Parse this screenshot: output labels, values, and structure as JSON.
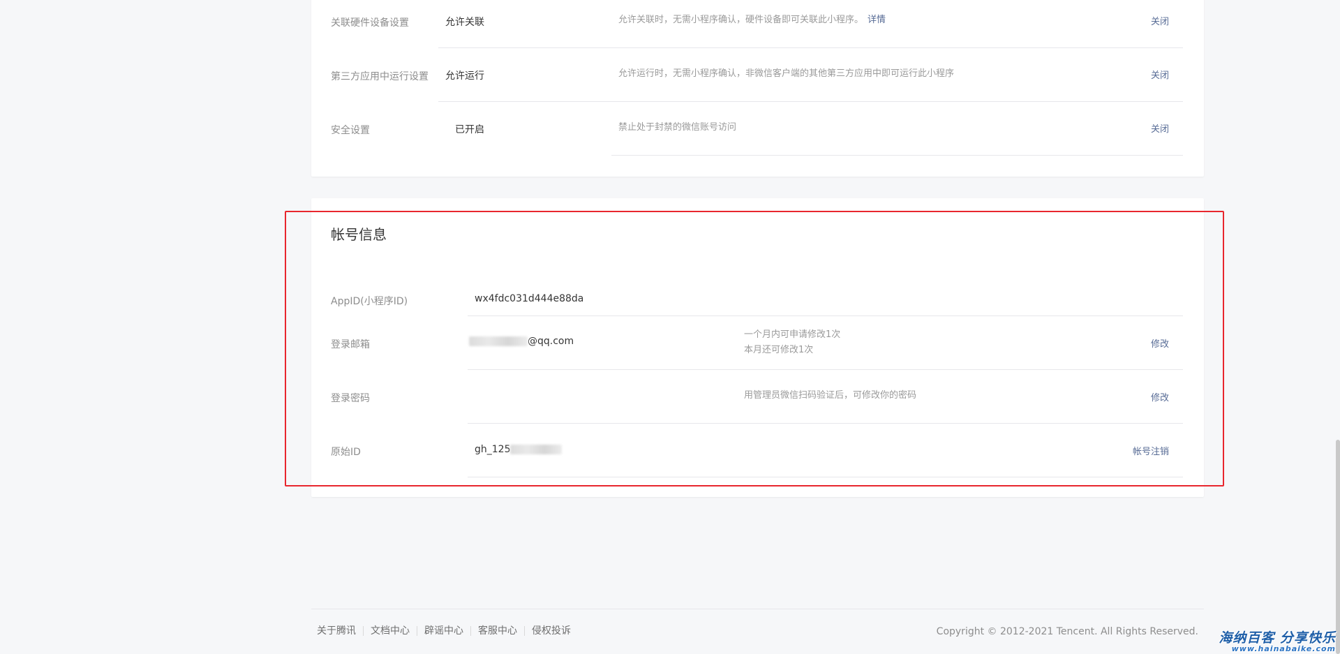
{
  "settings": {
    "rows": [
      {
        "label": "关联硬件设备设置",
        "value": "允许关联",
        "desc": "允许关联时，无需小程序确认，硬件设备即可关联此小程序。",
        "desc_link": "详情",
        "action": "关闭"
      },
      {
        "label": "第三方应用中运行设置",
        "value": "允许运行",
        "desc": "允许运行时，无需小程序确认，非微信客户端的其他第三方应用中即可运行此小程序",
        "action": "关闭"
      },
      {
        "label": "安全设置",
        "value": "已开启",
        "desc": "禁止处于封禁的微信账号访问",
        "action": "关闭"
      }
    ]
  },
  "account": {
    "title": "帐号信息",
    "appid": {
      "label": "AppID(小程序ID)",
      "value": "wx4fdc031d444e88da"
    },
    "email": {
      "label": "登录邮箱",
      "value_suffix": "@qq.com",
      "desc_line1": "一个月内可申请修改1次",
      "desc_line2": "本月还可修改1次",
      "action": "修改"
    },
    "password": {
      "label": "登录密码",
      "desc": "用管理员微信扫码验证后，可修改你的密码",
      "action": "修改"
    },
    "original_id": {
      "label": "原始ID",
      "value_prefix": "gh_125",
      "action": "帐号注销"
    }
  },
  "footer": {
    "links": [
      "关于腾讯",
      "文档中心",
      "辟谣中心",
      "客服中心",
      "侵权投诉"
    ],
    "copyright": "Copyright © 2012-2021 Tencent. All Rights Reserved."
  },
  "watermark": {
    "main": "海纳百客 分享快乐",
    "url": "www.hainabaike.com"
  },
  "colors": {
    "link": "#576b95",
    "highlight": "#e8262d",
    "background": "#f6f7f9"
  }
}
